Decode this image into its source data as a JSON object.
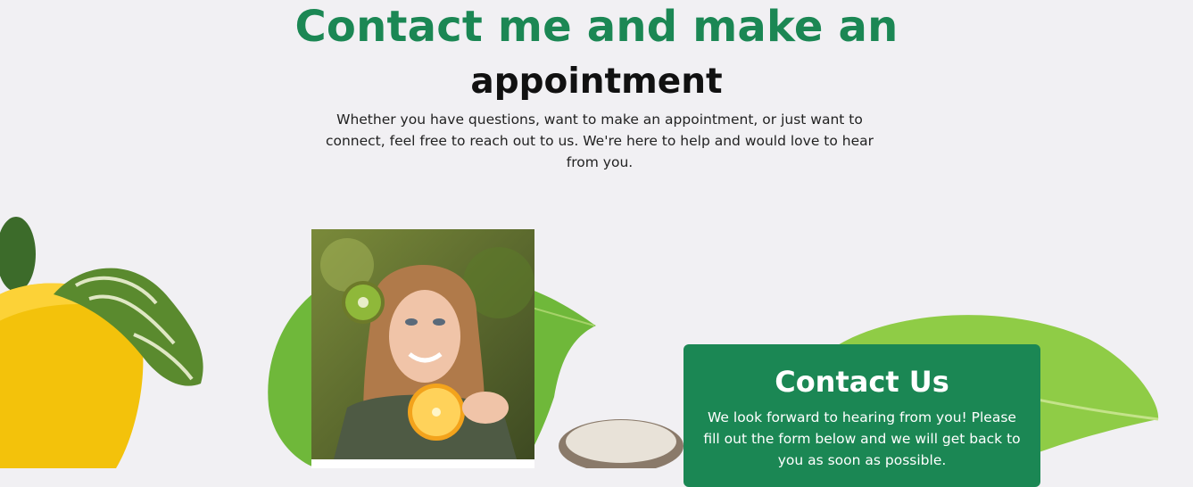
{
  "section": {
    "title_line1": "Contact me and make an",
    "title_line2": "appointment",
    "intro": "Whether you have questions, want to make an appointment, or just want to connect, feel free to reach out to us. We're here to help and would love to hear from you."
  },
  "contact_card": {
    "title": "Contact Us",
    "text": "We look forward to hearing from you! Please fill out the form below and we will get back to you as soon as possible."
  },
  "colors": {
    "brand_green": "#1b8754",
    "background": "#f1f0f3"
  },
  "images": {
    "portrait": "woman-holding-kiwi-and-orange-photo",
    "background": "vegetables-and-leaves-illustration"
  }
}
